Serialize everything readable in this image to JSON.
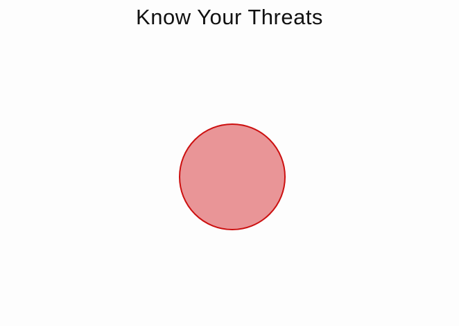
{
  "title": "Know Your Threats",
  "colors": {
    "background": "#fdfdfd",
    "title_text": "#111111",
    "circle_fill": "#e99597",
    "circle_stroke": "#cc1010"
  }
}
